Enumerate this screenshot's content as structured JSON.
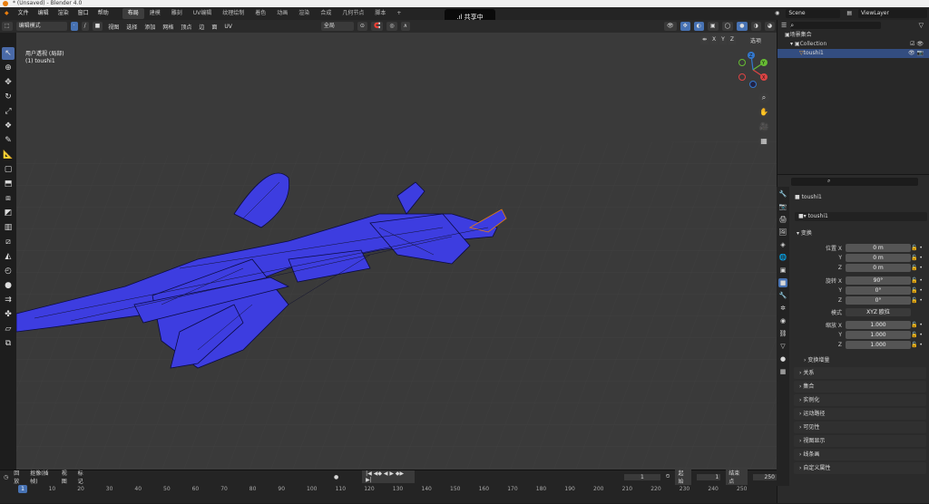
{
  "window": {
    "title": "* (Unsaved) - Blender 4.0"
  },
  "top_menu": [
    "文件",
    "编辑",
    "渲染",
    "窗口",
    "帮助"
  ],
  "workspaces": [
    "布局",
    "建模",
    "雕刻",
    "UV编辑",
    "纹理绘制",
    "着色",
    "动画",
    "渲染",
    "合成",
    "几何节点",
    "脚本"
  ],
  "workspace_add": "+",
  "share_banner": "共享中",
  "scene": {
    "label": "Scene"
  },
  "view_layer": {
    "label": "ViewLayer"
  },
  "viewport_header": {
    "mode": "编辑模式",
    "menus": [
      "视图",
      "选择",
      "添加",
      "网格",
      "顶点",
      "边",
      "面",
      "UV"
    ],
    "transform_orientation": "全局",
    "options": "选项",
    "axes": [
      "X",
      "Y",
      "Z"
    ]
  },
  "viewport_info": {
    "line1": "用户透视 (局部)",
    "line2": "(1) toushi1"
  },
  "gizmo": {
    "x": "X",
    "y": "Y",
    "z": "Z"
  },
  "outliner": {
    "root": "场景集合",
    "collection": "Collection",
    "object": "toushi1"
  },
  "properties": {
    "object_name": "toushi1",
    "object_field": "toushi1",
    "section_transform": "变换",
    "location": {
      "label": "位置 X",
      "x": "0 m",
      "y": "0 m",
      "z": "0 m"
    },
    "rotation": {
      "label": "旋转 X",
      "x": "90°",
      "y": "0°",
      "z": "0°"
    },
    "mode": {
      "label": "模式",
      "value": "XYZ 欧拉"
    },
    "scale": {
      "label": "缩放 X",
      "x": "1.000",
      "y": "1.000",
      "z": "1.000"
    },
    "axis_y": "Y",
    "axis_z": "Z",
    "delta_transform": "变换增量",
    "panels": [
      "关系",
      "集合",
      "实例化",
      "运动路径",
      "可见性",
      "视图显示",
      "线条画",
      "自定义属性"
    ]
  },
  "timeline": {
    "menus": [
      "回放",
      "抠像(插帧)",
      "视图",
      "标记"
    ],
    "current_frame": "1",
    "start_label": "起始",
    "start": "1",
    "end_label": "结束点",
    "end": "250",
    "ticks": [
      "0",
      "10",
      "20",
      "30",
      "40",
      "50",
      "60",
      "70",
      "80",
      "90",
      "100",
      "110",
      "120",
      "130",
      "140",
      "150",
      "160",
      "170",
      "180",
      "190",
      "200",
      "210",
      "220",
      "230",
      "240",
      "250"
    ],
    "playhead": "1"
  },
  "colors": {
    "mesh": "#3d3de0",
    "accent": "#4772b3",
    "header": "#2a2a2a"
  }
}
